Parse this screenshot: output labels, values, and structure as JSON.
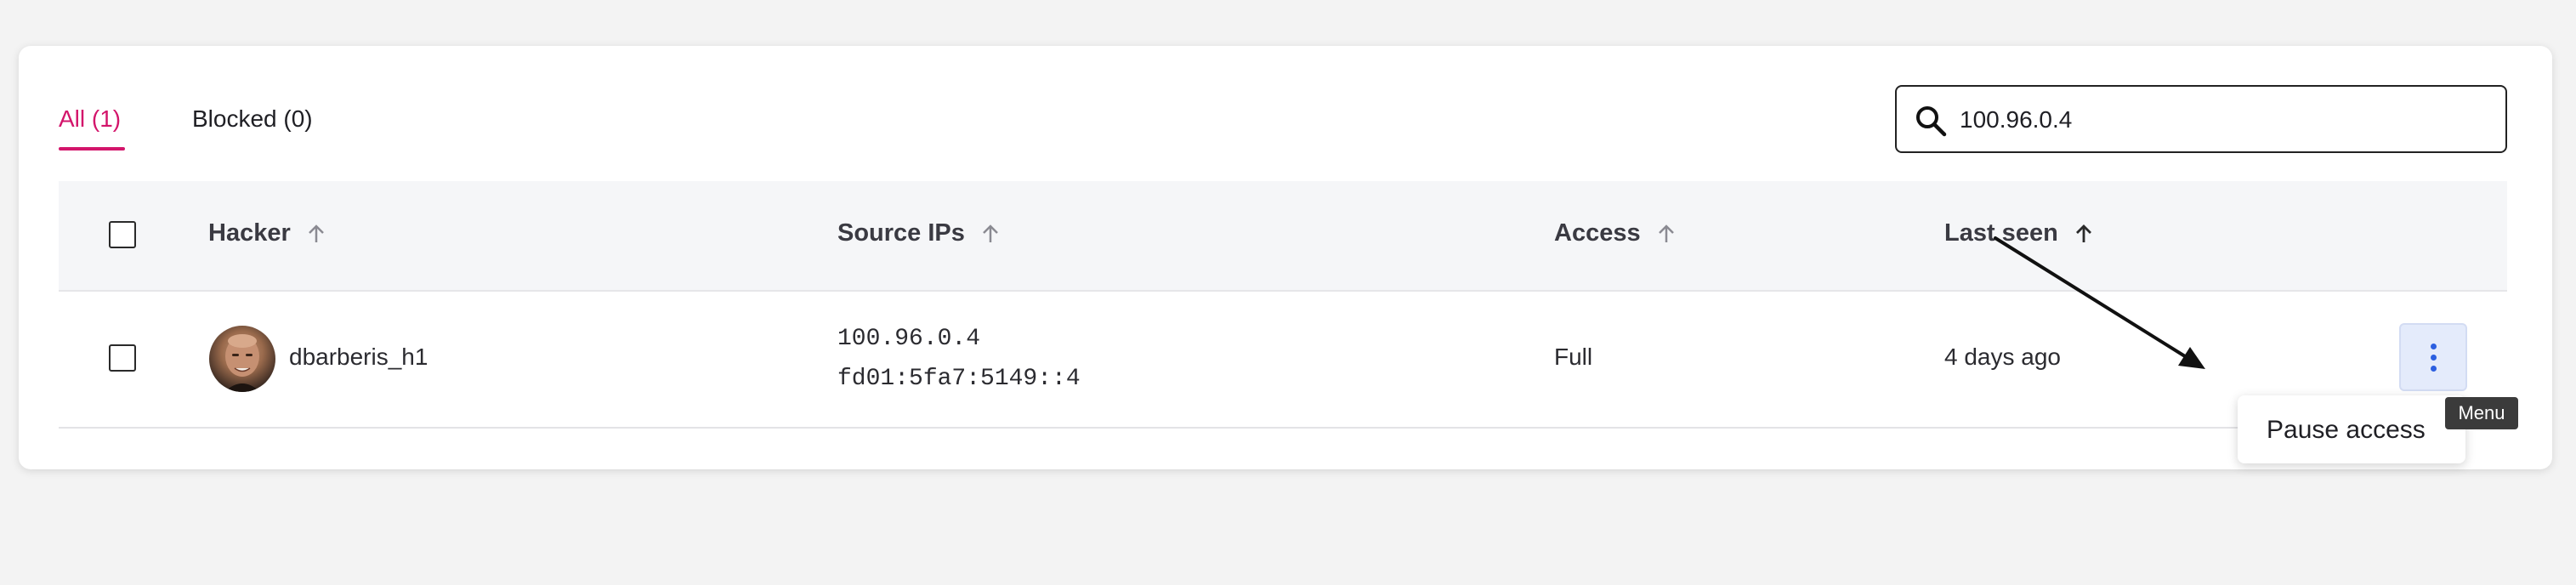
{
  "tabs": [
    {
      "label": "All (1)",
      "active": true
    },
    {
      "label": "Blocked (0)",
      "active": false
    }
  ],
  "search": {
    "value": "100.96.0.4",
    "placeholder": ""
  },
  "table": {
    "headers": [
      "Hacker",
      "Source IPs",
      "Access",
      "Last seen"
    ],
    "rows": [
      {
        "hacker": "dbarberis_h1",
        "source_ips": [
          "100.96.0.4",
          "fd01:5fa7:5149::4"
        ],
        "access": "Full",
        "last_seen": "4 days ago"
      }
    ]
  },
  "row_menu": {
    "tooltip": "Menu",
    "items": [
      "Pause access"
    ]
  },
  "colors": {
    "accent": "#d3156b",
    "menu_button_bg": "#e4ebfb",
    "menu_icon": "#2c5fe0"
  }
}
